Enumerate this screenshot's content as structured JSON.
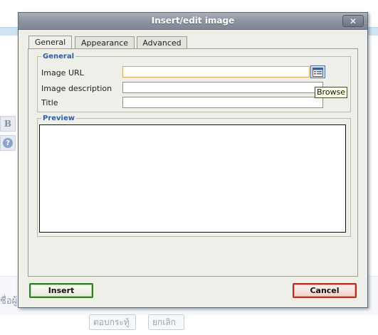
{
  "background": {
    "cut_text": "ชื่อผู้",
    "reply_button": "ตอบกระทู้",
    "cancel_button": "ยกเลิก",
    "bold_icon_glyph": "B",
    "help_icon_glyph": "?"
  },
  "dialog": {
    "title": "Insert/edit image",
    "close_glyph": "✕",
    "tabs": [
      {
        "label": "General",
        "active": true
      },
      {
        "label": "Appearance",
        "active": false
      },
      {
        "label": "Advanced",
        "active": false
      }
    ],
    "general": {
      "legend": "General",
      "image_url_label": "Image URL",
      "image_url_value": "",
      "image_description_label": "Image description",
      "image_description_value": "",
      "title_label": "Title",
      "title_value": "",
      "browse_icon": "browse-icon",
      "browse_tooltip": "Browse"
    },
    "preview": {
      "legend": "Preview"
    },
    "buttons": {
      "insert": "Insert",
      "cancel": "Cancel"
    }
  },
  "colors": {
    "accent_legend": "#2b5ca8",
    "insert_border": "#2e7a2e",
    "cancel_border": "#b12f25",
    "focused_field_border": "#e0a35a"
  }
}
